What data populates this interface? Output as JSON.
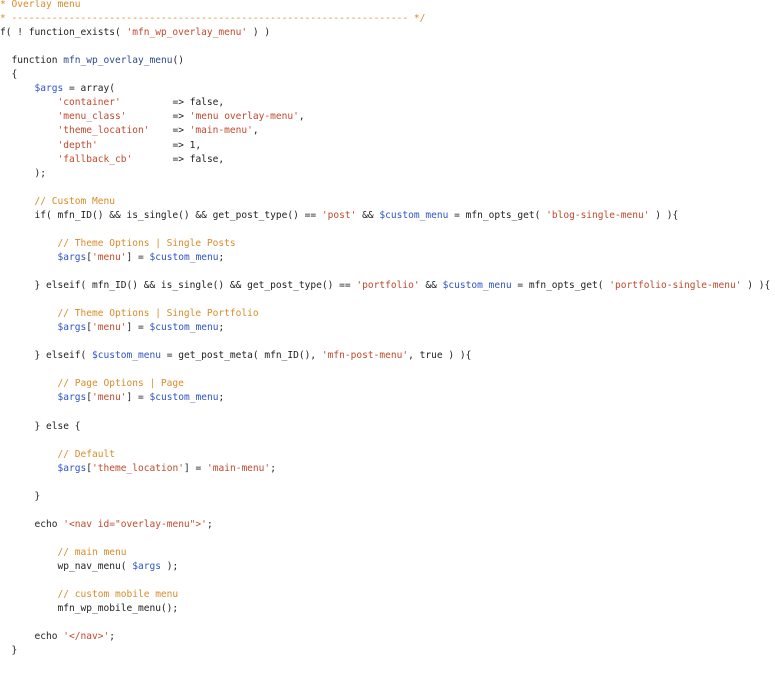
{
  "editor": {
    "lines": [
      [
        {
          "t": "* Overlay menu",
          "c": "comment"
        }
      ],
      [
        {
          "t": "* --------------------------------------------------------------------- */",
          "c": "comment"
        }
      ],
      [
        {
          "t": "f( ! function_exists( ",
          "c": "plain"
        },
        {
          "t": "'mfn_wp_overlay_menu'",
          "c": "string"
        },
        {
          "t": " ) )",
          "c": "plain"
        }
      ],
      [],
      [
        {
          "t": "  function ",
          "c": "plain"
        },
        {
          "t": "mfn_wp_overlay_menu",
          "c": "func"
        },
        {
          "t": "()",
          "c": "plain"
        }
      ],
      [
        {
          "t": "  {",
          "c": "plain"
        }
      ],
      [
        {
          "t": "      ",
          "c": "plain"
        },
        {
          "t": "$args",
          "c": "var"
        },
        {
          "t": " = array(",
          "c": "plain"
        }
      ],
      [
        {
          "t": "          ",
          "c": "plain"
        },
        {
          "t": "'container'",
          "c": "string"
        },
        {
          "t": "         => false,",
          "c": "plain"
        }
      ],
      [
        {
          "t": "          ",
          "c": "plain"
        },
        {
          "t": "'menu_class'",
          "c": "string"
        },
        {
          "t": "        => ",
          "c": "plain"
        },
        {
          "t": "'menu overlay-menu'",
          "c": "string"
        },
        {
          "t": ",",
          "c": "plain"
        }
      ],
      [
        {
          "t": "          ",
          "c": "plain"
        },
        {
          "t": "'theme_location'",
          "c": "string"
        },
        {
          "t": "    => ",
          "c": "plain"
        },
        {
          "t": "'main-menu'",
          "c": "string"
        },
        {
          "t": ",",
          "c": "plain"
        }
      ],
      [
        {
          "t": "          ",
          "c": "plain"
        },
        {
          "t": "'depth'",
          "c": "string"
        },
        {
          "t": "             => 1,",
          "c": "plain"
        }
      ],
      [
        {
          "t": "          ",
          "c": "plain"
        },
        {
          "t": "'fallback_cb'",
          "c": "string"
        },
        {
          "t": "       => false,",
          "c": "plain"
        }
      ],
      [
        {
          "t": "      );",
          "c": "plain"
        }
      ],
      [],
      [
        {
          "t": "      // Custom Menu",
          "c": "comment"
        }
      ],
      [
        {
          "t": "      if( mfn_ID() && is_single() && get_post_type() == ",
          "c": "plain"
        },
        {
          "t": "'post'",
          "c": "string"
        },
        {
          "t": " && ",
          "c": "plain"
        },
        {
          "t": "$custom_menu",
          "c": "var"
        },
        {
          "t": " = mfn_opts_get( ",
          "c": "plain"
        },
        {
          "t": "'blog-single-menu'",
          "c": "string"
        },
        {
          "t": " ) ){",
          "c": "plain"
        }
      ],
      [],
      [
        {
          "t": "          // Theme Options | Single Posts",
          "c": "comment"
        }
      ],
      [
        {
          "t": "          ",
          "c": "plain"
        },
        {
          "t": "$args",
          "c": "var"
        },
        {
          "t": "[",
          "c": "plain"
        },
        {
          "t": "'menu'",
          "c": "string"
        },
        {
          "t": "] = ",
          "c": "plain"
        },
        {
          "t": "$custom_menu",
          "c": "var"
        },
        {
          "t": ";",
          "c": "plain"
        }
      ],
      [],
      [
        {
          "t": "      } elseif( mfn_ID() && is_single() && get_post_type() == ",
          "c": "plain"
        },
        {
          "t": "'portfolio'",
          "c": "string"
        },
        {
          "t": " && ",
          "c": "plain"
        },
        {
          "t": "$custom_menu",
          "c": "var"
        },
        {
          "t": " = mfn_opts_get( ",
          "c": "plain"
        },
        {
          "t": "'portfolio-single-menu'",
          "c": "string"
        },
        {
          "t": " ) ){",
          "c": "plain"
        }
      ],
      [],
      [
        {
          "t": "          // Theme Options | Single Portfolio",
          "c": "comment"
        }
      ],
      [
        {
          "t": "          ",
          "c": "plain"
        },
        {
          "t": "$args",
          "c": "var"
        },
        {
          "t": "[",
          "c": "plain"
        },
        {
          "t": "'menu'",
          "c": "string"
        },
        {
          "t": "] = ",
          "c": "plain"
        },
        {
          "t": "$custom_menu",
          "c": "var"
        },
        {
          "t": ";",
          "c": "plain"
        }
      ],
      [],
      [
        {
          "t": "      } elseif( ",
          "c": "plain"
        },
        {
          "t": "$custom_menu",
          "c": "var"
        },
        {
          "t": " = get_post_meta( mfn_ID(), ",
          "c": "plain"
        },
        {
          "t": "'mfn-post-menu'",
          "c": "string"
        },
        {
          "t": ", true ) ){",
          "c": "plain"
        }
      ],
      [],
      [
        {
          "t": "          // Page Options | Page",
          "c": "comment"
        }
      ],
      [
        {
          "t": "          ",
          "c": "plain"
        },
        {
          "t": "$args",
          "c": "var"
        },
        {
          "t": "[",
          "c": "plain"
        },
        {
          "t": "'menu'",
          "c": "string"
        },
        {
          "t": "] = ",
          "c": "plain"
        },
        {
          "t": "$custom_menu",
          "c": "var"
        },
        {
          "t": ";",
          "c": "plain"
        }
      ],
      [],
      [
        {
          "t": "      } else {",
          "c": "plain"
        }
      ],
      [],
      [
        {
          "t": "          // Default",
          "c": "comment"
        }
      ],
      [
        {
          "t": "          ",
          "c": "plain"
        },
        {
          "t": "$args",
          "c": "var"
        },
        {
          "t": "[",
          "c": "plain"
        },
        {
          "t": "'theme_location'",
          "c": "string"
        },
        {
          "t": "] = ",
          "c": "plain"
        },
        {
          "t": "'main-menu'",
          "c": "string"
        },
        {
          "t": ";",
          "c": "plain"
        }
      ],
      [],
      [
        {
          "t": "      }",
          "c": "plain"
        }
      ],
      [],
      [
        {
          "t": "      echo ",
          "c": "plain"
        },
        {
          "t": "'<nav id=\"overlay-menu\">'",
          "c": "string"
        },
        {
          "t": ";",
          "c": "plain"
        }
      ],
      [],
      [
        {
          "t": "          // main menu",
          "c": "comment"
        }
      ],
      [
        {
          "t": "          wp_nav_menu( ",
          "c": "plain"
        },
        {
          "t": "$args",
          "c": "var"
        },
        {
          "t": " );",
          "c": "plain"
        }
      ],
      [],
      [
        {
          "t": "          // custom mobile menu",
          "c": "comment"
        }
      ],
      [
        {
          "t": "          mfn_wp_mobile_menu();",
          "c": "plain"
        }
      ],
      [],
      [
        {
          "t": "      echo ",
          "c": "plain"
        },
        {
          "t": "'</nav>'",
          "c": "string"
        },
        {
          "t": ";",
          "c": "plain"
        }
      ],
      [
        {
          "t": "  }",
          "c": "plain"
        }
      ]
    ],
    "colors": {
      "plain": "#222222",
      "comment": "#d98b2b",
      "string": "#c2492e",
      "var": "#2f54c8",
      "func": "#2e4b8f"
    }
  }
}
